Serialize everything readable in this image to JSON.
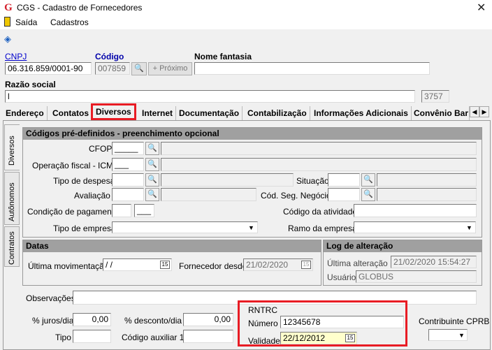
{
  "window": {
    "title": "CGS - Cadastro de Fornecedores",
    "app_icon": "G"
  },
  "menu": {
    "items": [
      "Saída",
      "Cadastros"
    ]
  },
  "header": {
    "cnpj_label": "CNPJ",
    "cnpj_value": "06.316.859/0001-90",
    "codigo_label": "Código",
    "codigo_value": "007859",
    "proximo_label": "Próximo",
    "nome_fantasia_label": "Nome fantasia",
    "nome_fantasia_value": "",
    "razao_social_label": "Razão social",
    "razao_social_value": "l",
    "razao_count": "3757"
  },
  "tabs": [
    "Endereço",
    "Contatos",
    "Diversos",
    "Internet",
    "Documentação",
    "Contabilização",
    "Informações Adicionais",
    "Convênio Bar"
  ],
  "active_tab": "Diversos",
  "side_tabs": [
    "Diversos",
    "Autônomos",
    "Contratos"
  ],
  "codigos": {
    "heading": "Códigos pré-definidos - preenchimento opcional",
    "cfop_label": "CFOP",
    "cfop_value": "_____",
    "operacao_label": "Operação fiscal - ICMS",
    "operacao_value": "___",
    "tipo_despesa_label": "Tipo de despesa",
    "situacao_label": "Situação",
    "avaliacao_label": "Avaliação",
    "cod_seg_label": "Cód. Seg. Negócio",
    "condicao_label": "Condição de pagamento",
    "condicao_value2": "___",
    "codigo_atividade_label": "Código da atividade",
    "tipo_empresa_label": "Tipo de empresa",
    "ramo_empresa_label": "Ramo da empresa"
  },
  "datas": {
    "heading": "Datas",
    "ultima_mov_label": "Última movimentação",
    "ultima_mov_value": " / /",
    "fornecedor_desde_label": "Fornecedor desde",
    "fornecedor_desde_value": "21/02/2020"
  },
  "log": {
    "heading": "Log de alteração",
    "ultima_alt_label": "Última alteração",
    "ultima_alt_value": "21/02/2020 15:54:27",
    "usuario_label": "Usuário",
    "usuario_value": "GLOBUS"
  },
  "bottom": {
    "observacoes_label": "Observações",
    "juros_label": "% juros/dia",
    "juros_value": "0,00",
    "desconto_label": "% desconto/dia",
    "desconto_value": "0,00",
    "tipo_label": "Tipo",
    "cod_aux_label": "Código auxiliar 1",
    "contribuinte_label": "Contribuinte CPRB"
  },
  "rntrc": {
    "heading": "RNTRC",
    "numero_label": "Número",
    "numero_value": "12345678",
    "validade_label": "Validade",
    "validade_value": "22/12/2012"
  },
  "icons": {
    "calendar": "15",
    "binoculars": "🔍",
    "plus": "+"
  },
  "colors": {
    "highlight": "#e81c24",
    "link": "#0000cc",
    "section": "#a0a0a0"
  }
}
